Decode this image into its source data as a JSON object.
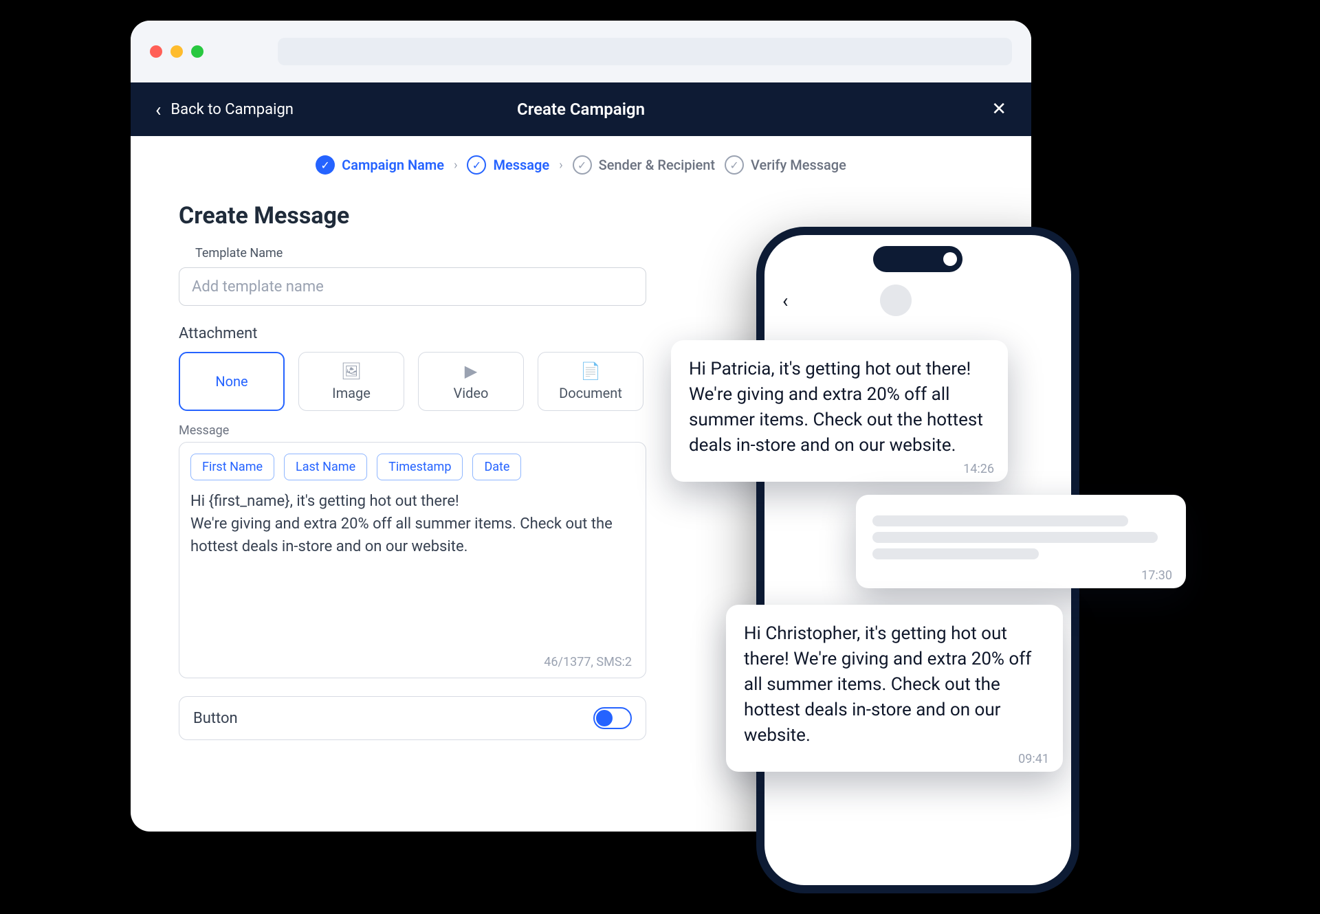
{
  "header": {
    "back_label": "Back to Campaign",
    "title": "Create Campaign"
  },
  "stepper": {
    "steps": [
      {
        "label": "Campaign Name",
        "state": "done"
      },
      {
        "label": "Message",
        "state": "active"
      },
      {
        "label": "Sender & Recipient",
        "state": "todo"
      },
      {
        "label": "Verify Message",
        "state": "todo"
      }
    ]
  },
  "page_title": "Create Message",
  "template_name": {
    "label": "Template Name",
    "placeholder": "Add template name",
    "value": ""
  },
  "attachment": {
    "label": "Attachment",
    "options": [
      {
        "key": "none",
        "label": "None",
        "selected": true
      },
      {
        "key": "image",
        "label": "Image",
        "selected": false
      },
      {
        "key": "video",
        "label": "Video",
        "selected": false
      },
      {
        "key": "document",
        "label": "Document",
        "selected": false
      }
    ]
  },
  "message": {
    "label": "Message",
    "chips": [
      "First Name",
      "Last Name",
      "Timestamp",
      "Date"
    ],
    "body": "Hi {first_name}, it's getting hot out there!\nWe're giving and extra 20% off all summer items. Check out the hottest deals in-store and on our website.",
    "counter": "46/1377, SMS:2"
  },
  "button_toggle": {
    "label": "Button",
    "on": true
  },
  "preview": {
    "bubble1": {
      "text": "Hi Patricia, it's getting hot out there! We're giving and extra 20% off all summer items. Check out the hottest deals in-store and on our website.",
      "time": "14:26"
    },
    "bubble2": {
      "text": "Hi Christopher, it's getting hot out there! We're giving and extra 20% off all summer items. Check out the hottest deals in-store and on our website.",
      "time": "09:41"
    },
    "inbound": {
      "time": "17:30"
    }
  }
}
